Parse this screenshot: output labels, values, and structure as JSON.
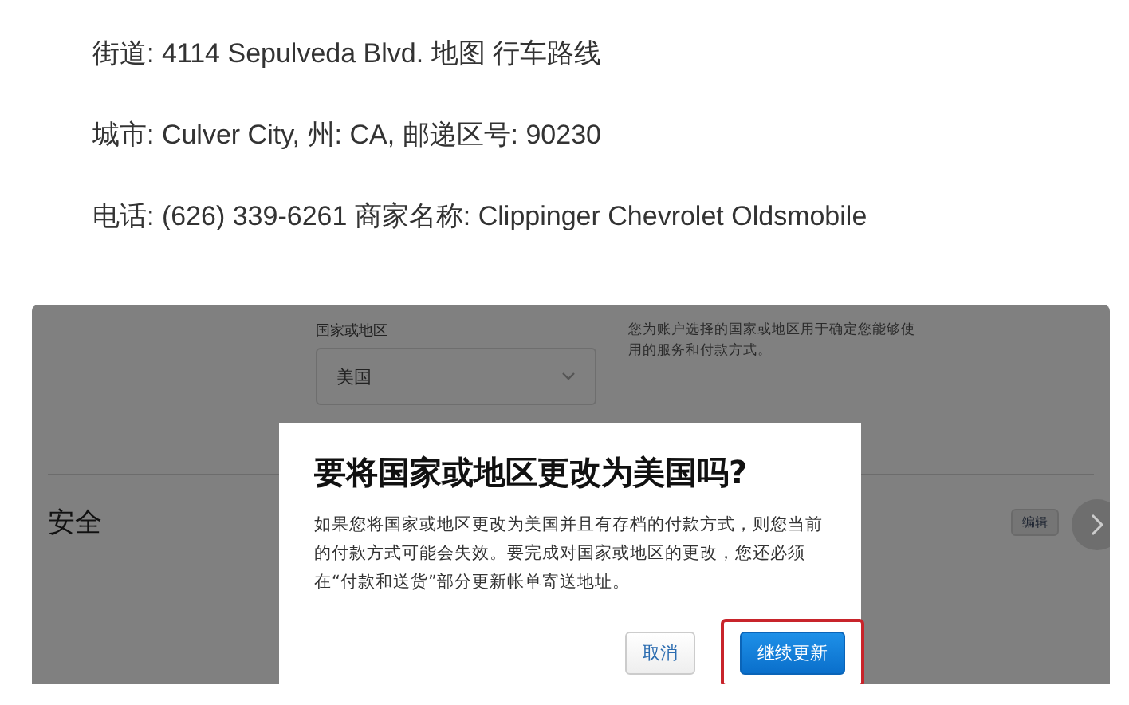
{
  "info_lines": [
    "街道: 4114 Sepulveda Blvd. 地图 行车路线",
    "城市: Culver City, 州: CA, 邮递区号: 90230",
    "电话: (626) 339-6261 商家名称: Clippinger Chevrolet Oldsmobile"
  ],
  "screenshot": {
    "country_field": {
      "label": "国家或地区",
      "value": "美国"
    },
    "help_text": "您为账户选择的国家或地区用于确定您能够使用的服务和付款方式。",
    "section_title": "安全",
    "edit_button": "编辑",
    "dialog": {
      "title": "要将国家或地区更改为美国吗?",
      "body": "如果您将国家或地区更改为美国并且有存档的付款方式，则您当前的付款方式可能会失效。要完成对国家或地区的更改，您还必须在“付款和送货”部分更新帐单寄送地址。",
      "buttons": [
        {
          "label": "取消",
          "kind": "secondary",
          "highlighted": false
        },
        {
          "label": "继续更新",
          "kind": "primary",
          "highlighted": true
        }
      ]
    }
  }
}
